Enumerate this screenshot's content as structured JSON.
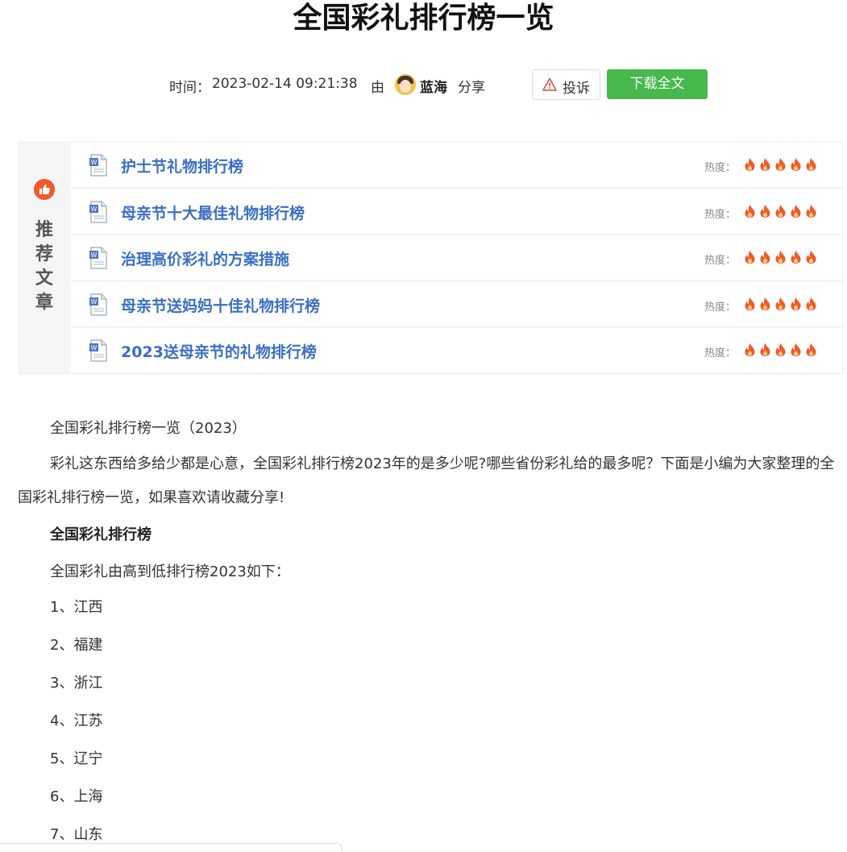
{
  "title": "全国彩礼排行榜一览",
  "meta": {
    "time_label": "时间：",
    "time_value": "2023-02-14 09:21:38",
    "by": "由",
    "username": "蓝海",
    "share": "分享",
    "report": "投诉",
    "download": "下载全文"
  },
  "recommend": {
    "label": "推\n荐\n文\n章",
    "heat_label": "热度：",
    "items": [
      {
        "title": "护士节礼物排行榜",
        "heat": 5
      },
      {
        "title": "母亲节十大最佳礼物排行榜",
        "heat": 5
      },
      {
        "title": "治理高价彩礼的方案措施",
        "heat": 5
      },
      {
        "title": "母亲节送妈妈十佳礼物排行榜",
        "heat": 5
      },
      {
        "title": "2023送母亲节的礼物排行榜",
        "heat": 5
      }
    ]
  },
  "article": {
    "subtitle": "全国彩礼排行榜一览（2023）",
    "intro": "彩礼这东西给多给少都是心意，全国彩礼排行榜2023年的是多少呢?哪些省份彩礼给的最多呢？下面是小编为大家整理的全国彩礼排行榜一览，如果喜欢请收藏分享!",
    "heading": "全国彩礼排行榜",
    "lead": "全国彩礼由高到低排行榜2023如下：",
    "list": [
      "1、江西",
      "2、福建",
      "3、浙江",
      "4、江苏",
      "5、辽宁",
      "6、上海",
      "7、山东"
    ]
  },
  "colors": {
    "link": "#3a6fc4",
    "download_bg": "#46b84c",
    "flame": "#f05a2a"
  }
}
